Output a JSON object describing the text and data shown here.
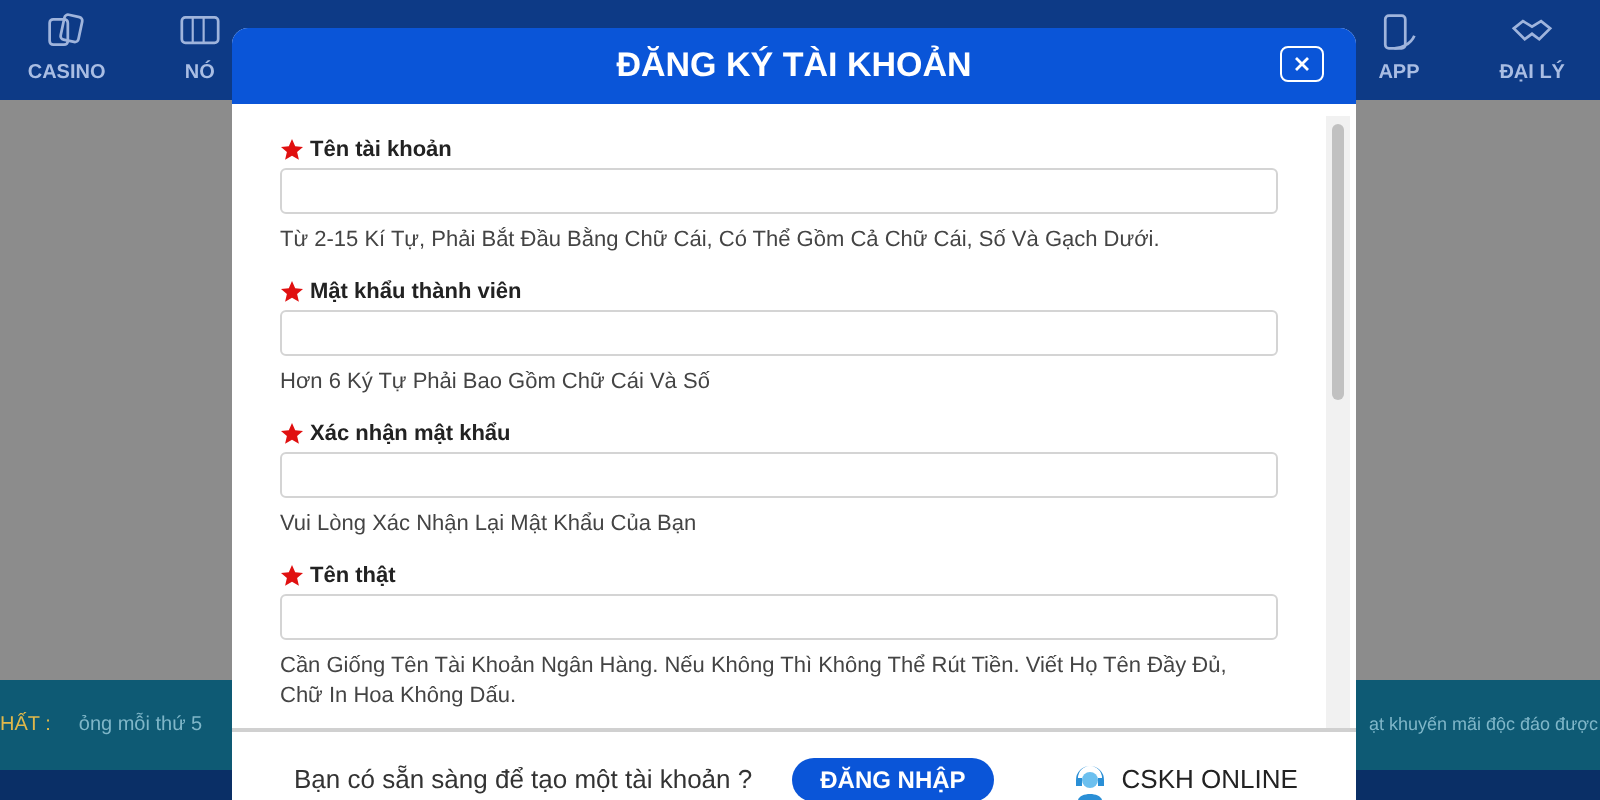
{
  "nav": {
    "items": [
      {
        "label": "CASINO"
      },
      {
        "label": "NÓ"
      },
      {
        "label": "APP"
      },
      {
        "label": "ĐẠI LÝ"
      }
    ]
  },
  "marquee": {
    "label": "HẤT :",
    "left_text": "ỏng mỗi thứ 5",
    "right_text": "ạt khuyến mãi độc đáo được"
  },
  "dialog": {
    "title": "ĐĂNG KÝ TÀI KHOẢN",
    "fields": [
      {
        "label": "Tên tài khoản",
        "required": true,
        "hint": "Từ 2-15 Kí Tự, Phải Bắt Đầu Bằng Chữ Cái, Có Thể Gồm Cả Chữ Cái, Số Và Gạch Dưới."
      },
      {
        "label": "Mật khẩu thành viên",
        "required": true,
        "hint": "Hơn 6 Ký Tự Phải Bao Gồm Chữ Cái Và Số"
      },
      {
        "label": "Xác nhận mật khẩu",
        "required": true,
        "hint": "Vui Lòng Xác Nhận Lại Mật Khẩu Của Bạn"
      },
      {
        "label": "Tên thật",
        "required": true,
        "hint": "Cần Giống Tên Tài Khoản Ngân Hàng. Nếu Không Thì Không Thể Rút Tiền. Viết Họ Tên Đầy Đủ, Chữ In Hoa Không Dấu."
      }
    ],
    "footer": {
      "prompt": "Bạn có sẵn sàng để tạo một tài khoản ?",
      "login_button": "ĐĂNG NHẬP",
      "support_link": "CSKH ONLINE"
    }
  }
}
